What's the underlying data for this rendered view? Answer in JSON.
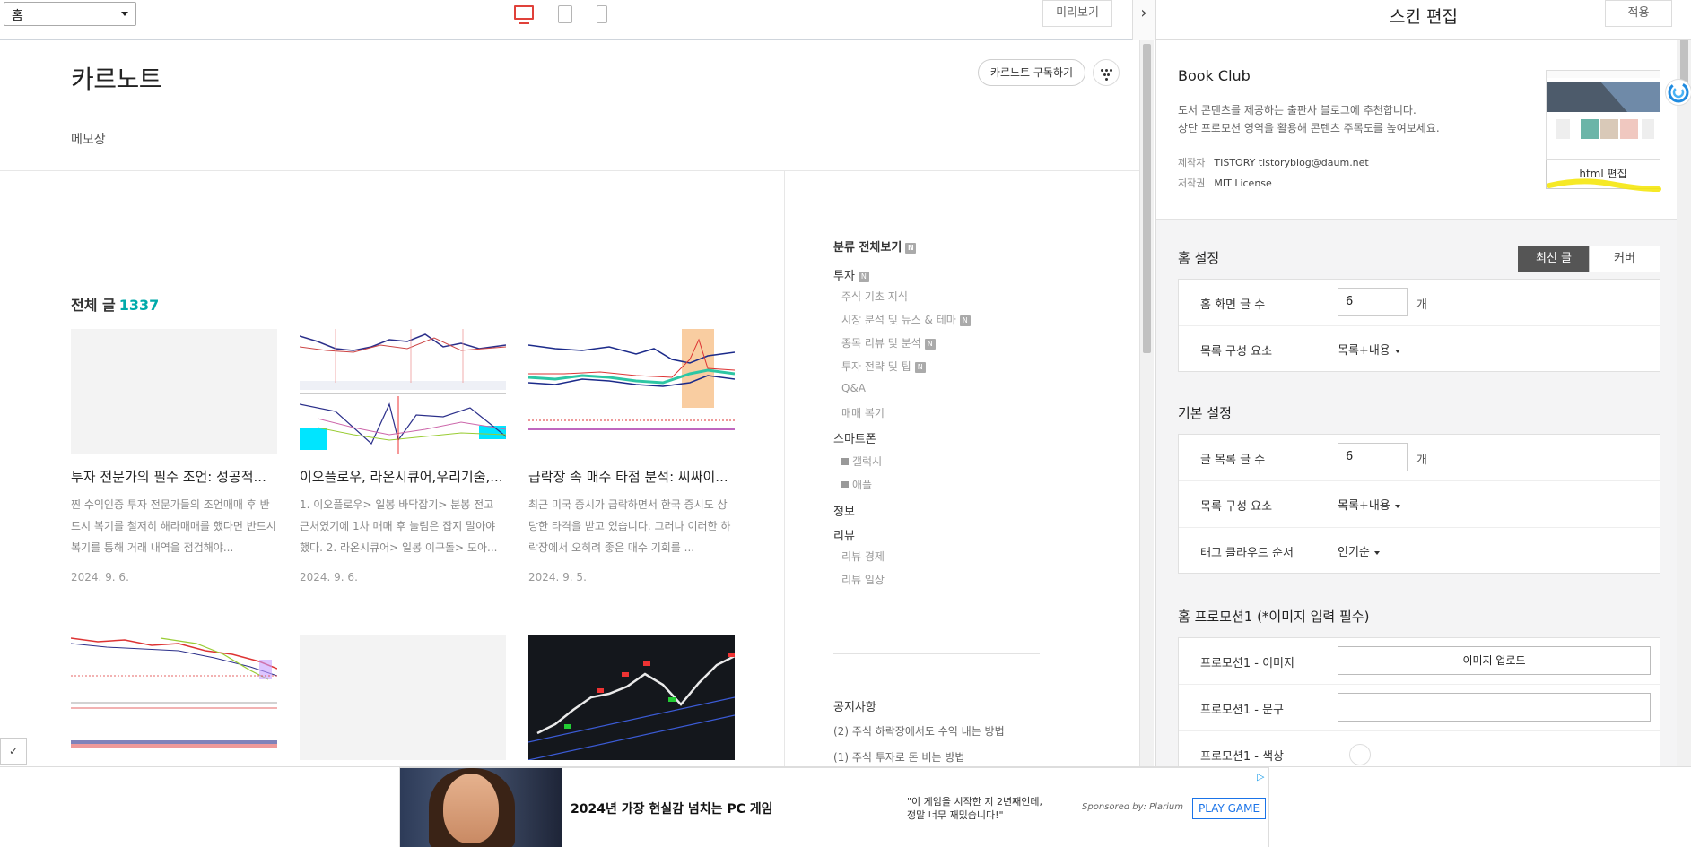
{
  "toolbar": {
    "page_select": "홈",
    "preview_label": "미리보기",
    "collapse_glyph": "›"
  },
  "blog": {
    "title": "카르노트",
    "subscribe_label": "카르노트 구독하기",
    "nav_memo": "메모장",
    "posts_heading": "전체 글",
    "posts_count": "1337",
    "posts": [
      {
        "title": "투자 전문가의 필수 조언: 성공적...",
        "excerpt": "찐 수익인증 투자 전문가들의 조언매매 후 반드시 복기를 철저히 해라매매를 했다면 반드시 복기를 통해 거래 내역을 점검해야...",
        "date": "2024. 9. 6."
      },
      {
        "title": "이오플로우, 라온시큐어,우리기술,...",
        "excerpt": "1. 이오플로우> 일봉 바닥잡기> 분봉 전고 근처였기에 1차 매매 후 눌림은 잡지 말아야 했다. 2. 라온시큐어> 일봉 이구돌> 모아...",
        "date": "2024. 9. 6."
      },
      {
        "title": "급락장 속 매수 타점 분석: 씨싸이...",
        "excerpt": "최근 미국 증시가 급락하면서 한국 증시도 상당한 타격을 받고 있습니다. 그러나 이러한 하락장에서 오히려 좋은 매수 기회를 ...",
        "date": "2024. 9. 5."
      }
    ],
    "category": {
      "all_label": "분류 전체보기",
      "new_badge": "N",
      "groups": [
        {
          "label": "투자",
          "new": true
        },
        {
          "label": "주식 기초 지식",
          "new": false
        },
        {
          "label": "시장 분석 및 뉴스 & 테마",
          "new": true
        },
        {
          "label": "종목 리뷰 및 분석",
          "new": true
        },
        {
          "label": "투자 전략 및 팁",
          "new": true
        },
        {
          "label": "Q&A",
          "new": false
        },
        {
          "label": "매매 복기",
          "new": false
        },
        {
          "label": "스마트폰",
          "new": false
        },
        {
          "label": "갤럭시",
          "new": false
        },
        {
          "label": "애플",
          "new": false
        },
        {
          "label": "정보",
          "new": false
        },
        {
          "label": "리뷰",
          "new": false
        },
        {
          "label": "리뷰 경제",
          "new": false
        },
        {
          "label": "리뷰 일상",
          "new": false
        }
      ]
    },
    "notice_title": "공지사항",
    "notices": [
      "(2) 주식 하락장에서도 수익 내는 방법",
      "(1) 주식 투자로 돈 버는 방법"
    ],
    "bottom_tab_glyph": "✓"
  },
  "ad": {
    "headline": "2024년 가장 현실감 넘치는 PC 게임",
    "quote_line1": "\"이 게임을 시작한 지 2년째인데,",
    "quote_line2": "정말 너무 재밌습니다!\"",
    "sponsor": "Sponsored by: Plarium",
    "cta": "PLAY GAME",
    "choices_glyph": "▷"
  },
  "skin": {
    "panel_title": "스킨 편집",
    "apply_label": "적용",
    "name": "Book Club",
    "description_line1": "도서 콘텐츠를 제공하는 출판사 블로그에 추천합니다.",
    "description_line2": "상단 프로모션 영역을 활용해 콘텐츠 주목도를 높여보세요.",
    "maker_key": "제작자",
    "maker_value": "TISTORY  tistoryblog@daum.net",
    "license_key": "저작권",
    "license_value": "MIT License",
    "html_edit_label": "html 편집",
    "highlight_color": "#f5e500",
    "home_settings": {
      "title": "홈 설정",
      "toggle_latest": "최신 글",
      "toggle_cover": "커버",
      "rows": [
        {
          "label": "홈 화면 글 수",
          "value": "6",
          "unit": "개"
        },
        {
          "label": "목록 구성 요소",
          "value": "목록+내용"
        }
      ]
    },
    "basic_settings": {
      "title": "기본 설정",
      "rows": [
        {
          "label": "글 목록 글 수",
          "value": "6",
          "unit": "개"
        },
        {
          "label": "목록 구성 요소",
          "value": "목록+내용"
        },
        {
          "label": "태그 클라우드 순서",
          "value": "인기순"
        }
      ]
    },
    "promo1": {
      "title": "홈 프로모션1 (*이미지 입력 필수)",
      "rows": [
        {
          "label": "프로모션1 - 이미지",
          "value": "이미지 업로드"
        },
        {
          "label": "프로모션1 - 문구",
          "value": ""
        },
        {
          "label": "프로모션1 - 색상",
          "value": ""
        }
      ]
    }
  },
  "colors": {
    "accent_count": "#00aaaa",
    "active_toggle": "#555555",
    "desktop_icon": "#e0413a"
  }
}
